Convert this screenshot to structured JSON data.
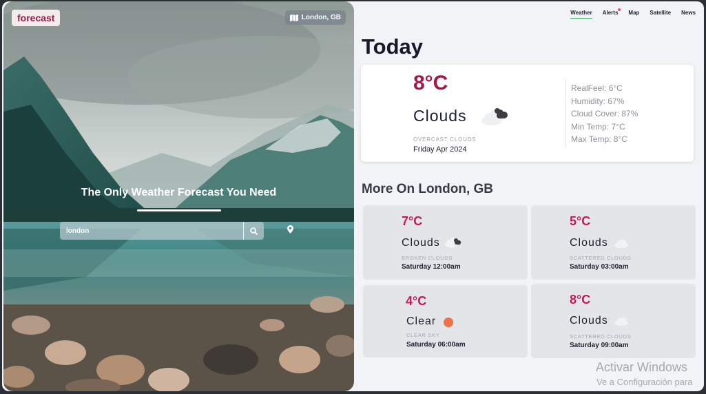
{
  "brand": "forecast",
  "location_chip": "London, GB",
  "hero": {
    "title": "The Only Weather Forecast You Need",
    "search_value": "london"
  },
  "nav": [
    "Weather",
    "Alerts",
    "Map",
    "Satellite",
    "News"
  ],
  "today": {
    "heading": "Today",
    "temp": "8°C",
    "condition": "Clouds",
    "description": "OVERCAST CLOUDS",
    "date": "Friday Apr 2024",
    "details": [
      "RealFeel: 6°C",
      "Humidity: 67%",
      "Cloud Cover: 87%",
      "Min Temp: 7°C",
      "Max Temp: 8°C"
    ]
  },
  "more": {
    "heading": "More On London, GB",
    "items": [
      {
        "temp": "7°C",
        "condition": "Clouds",
        "description": "BROKEN CLOUDS",
        "time": "Saturday 12:00am",
        "icon": "broken-clouds-icon"
      },
      {
        "temp": "5°C",
        "condition": "Clouds",
        "description": "SCATTERED CLOUDS",
        "time": "Saturday 03:00am",
        "icon": "scattered-clouds-icon"
      },
      {
        "temp": "4°C",
        "condition": "Clear",
        "description": "CLEAR SKY",
        "time": "Saturday 06:00am",
        "icon": "sun-icon"
      },
      {
        "temp": "8°C",
        "condition": "Clouds",
        "description": "SCATTERED CLOUDS",
        "time": "Saturday 09:00am",
        "icon": "scattered-clouds-icon"
      }
    ]
  },
  "watermark": {
    "line1": "Activar Windows",
    "line2": "Ve a Configuración para"
  },
  "colors": {
    "accent_temp": "#a21a44",
    "forecast_temp": "#c41a5a",
    "active_tab": "#3fb56a",
    "sun": "#ef7049"
  }
}
